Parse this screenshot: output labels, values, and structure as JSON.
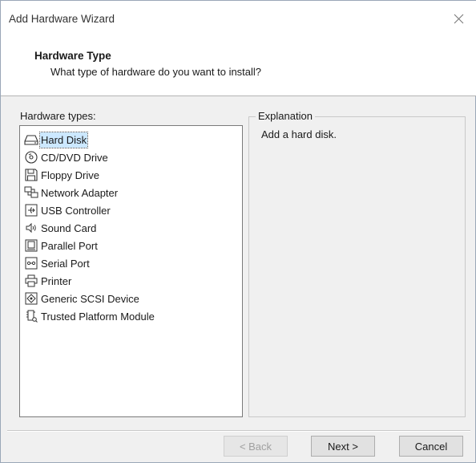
{
  "window": {
    "title": "Add Hardware Wizard",
    "close_icon": "close-icon"
  },
  "header": {
    "title": "Hardware Type",
    "subtitle": "What type of hardware do you want to install?"
  },
  "hardware_list": {
    "label": "Hardware types:",
    "selected": "Hard Disk",
    "items": [
      {
        "label": "Hard Disk",
        "icon": "hard-disk-icon"
      },
      {
        "label": "CD/DVD Drive",
        "icon": "cd-dvd-drive-icon"
      },
      {
        "label": "Floppy Drive",
        "icon": "floppy-drive-icon"
      },
      {
        "label": "Network Adapter",
        "icon": "network-adapter-icon"
      },
      {
        "label": "USB Controller",
        "icon": "usb-controller-icon"
      },
      {
        "label": "Sound Card",
        "icon": "sound-card-icon"
      },
      {
        "label": "Parallel Port",
        "icon": "parallel-port-icon"
      },
      {
        "label": "Serial Port",
        "icon": "serial-port-icon"
      },
      {
        "label": "Printer",
        "icon": "printer-icon"
      },
      {
        "label": "Generic SCSI Device",
        "icon": "scsi-device-icon"
      },
      {
        "label": "Trusted Platform Module",
        "icon": "tpm-icon"
      }
    ]
  },
  "explanation": {
    "label": "Explanation",
    "text": "Add a hard disk."
  },
  "buttons": {
    "back": "< Back",
    "next": "Next >",
    "cancel": "Cancel"
  },
  "colors": {
    "selection": "#cce8ff",
    "dialog_bg": "#f0f0f0"
  }
}
